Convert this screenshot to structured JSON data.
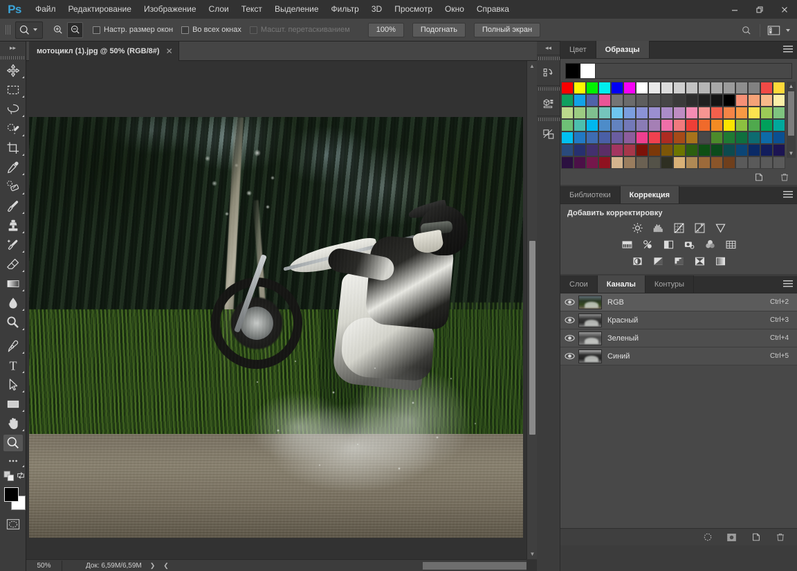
{
  "app": {
    "logo": "Ps",
    "title": "Adobe Photoshop"
  },
  "menubar": {
    "items": [
      {
        "label": "Файл"
      },
      {
        "label": "Редактирование"
      },
      {
        "label": "Изображение"
      },
      {
        "label": "Слои"
      },
      {
        "label": "Текст"
      },
      {
        "label": "Выделение"
      },
      {
        "label": "Фильтр"
      },
      {
        "label": "3D"
      },
      {
        "label": "Просмотр"
      },
      {
        "label": "Окно"
      },
      {
        "label": "Справка"
      }
    ]
  },
  "window_controls": {
    "minimize": "—",
    "restore": "❐",
    "close": "✕"
  },
  "optionsbar": {
    "tool_icon": "zoom-tool-icon",
    "zoom_in_icon": "zoom-in-icon",
    "zoom_out_icon": "zoom-out-icon",
    "checkboxes": [
      {
        "label": "Настр. размер окон",
        "checked": false,
        "disabled": false
      },
      {
        "label": "Во всех окнах",
        "checked": false,
        "disabled": false
      },
      {
        "label": "Масшт. перетаскиванием",
        "checked": false,
        "disabled": true
      }
    ],
    "buttons": [
      {
        "label": "100%"
      },
      {
        "label": "Подогнать"
      },
      {
        "label": "Полный экран"
      }
    ],
    "search_icon": "search-icon",
    "workspace_icon": "workspace-switcher-icon"
  },
  "toolbar": {
    "collapse_icon": "expand-arrows-icon",
    "tools": [
      {
        "name": "move-tool",
        "label": "Перемещение",
        "selected": false,
        "has_submenu": true
      },
      {
        "name": "marquee-tool",
        "label": "Прямоугольная область",
        "selected": false,
        "has_submenu": true
      },
      {
        "name": "lasso-tool",
        "label": "Лассо",
        "selected": false,
        "has_submenu": true
      },
      {
        "name": "quick-selection-tool",
        "label": "Быстрое выделение",
        "selected": false,
        "has_submenu": true
      },
      {
        "name": "crop-tool",
        "label": "Рамка",
        "selected": false,
        "has_submenu": true
      },
      {
        "name": "eyedropper-tool",
        "label": "Пипетка",
        "selected": false,
        "has_submenu": true
      },
      {
        "name": "healing-brush-tool",
        "label": "Восстанавливающая кисть",
        "selected": false,
        "has_submenu": true
      },
      {
        "name": "brush-tool",
        "label": "Кисть",
        "selected": false,
        "has_submenu": true
      },
      {
        "name": "clone-stamp-tool",
        "label": "Штамп",
        "selected": false,
        "has_submenu": true
      },
      {
        "name": "history-brush-tool",
        "label": "Архивная кисть",
        "selected": false,
        "has_submenu": true
      },
      {
        "name": "eraser-tool",
        "label": "Ластик",
        "selected": false,
        "has_submenu": true
      },
      {
        "name": "gradient-tool",
        "label": "Градиент",
        "selected": false,
        "has_submenu": true
      },
      {
        "name": "blur-tool",
        "label": "Размытие",
        "selected": false,
        "has_submenu": true
      },
      {
        "name": "dodge-tool",
        "label": "Осветлитель",
        "selected": false,
        "has_submenu": true
      },
      {
        "name": "pen-tool",
        "label": "Перо",
        "selected": false,
        "has_submenu": true
      },
      {
        "name": "type-tool",
        "label": "Текст",
        "selected": false,
        "has_submenu": true
      },
      {
        "name": "path-selection-tool",
        "label": "Выделение контура",
        "selected": false,
        "has_submenu": true
      },
      {
        "name": "rectangle-tool",
        "label": "Прямоугольник",
        "selected": false,
        "has_submenu": true
      },
      {
        "name": "hand-tool",
        "label": "Рука",
        "selected": false,
        "has_submenu": true
      },
      {
        "name": "zoom-tool",
        "label": "Масштаб",
        "selected": true,
        "has_submenu": false
      },
      {
        "name": "edit-toolbar-tool",
        "label": "Редактировать панель инструментов",
        "selected": false,
        "has_submenu": true
      }
    ],
    "swap_colors_icon": "swap-colors-icon",
    "default_colors_icon": "default-colors-icon",
    "foreground_color": "#000000",
    "background_color": "#ffffff",
    "quick_mask_icon": "quick-mask-icon"
  },
  "document": {
    "tab_title": "мотоцикл (1).jpg @ 50% (RGB/8#)",
    "close_label": "✕",
    "zoom_level": "50%",
    "doc_info": "Док: 6,59M/6,59M",
    "next_arrow": "❯",
    "prev_arrow": "❮",
    "image_description": "Мотоциклист на кроссовом мотоцикле в брызгах воды"
  },
  "icon_dock": {
    "collapse_icon": "collapse-arrows-icon",
    "items": [
      {
        "name": "history-panel-icon",
        "label": "История"
      },
      {
        "name": "properties-3d-panel-icon",
        "label": "3D"
      },
      {
        "name": "styles-panel-icon",
        "label": "Стили"
      }
    ]
  },
  "swatches_panel": {
    "tabs": [
      {
        "label": "Цвет",
        "active": false,
        "name": "tab-color"
      },
      {
        "label": "Образцы",
        "active": true,
        "name": "tab-swatches"
      }
    ],
    "menu_icon": "panel-menu-icon",
    "current_pair": {
      "foreground": "#000000",
      "background": "#ffffff"
    },
    "footer_buttons": [
      {
        "name": "new-swatch-button",
        "icon": "new-page-icon"
      },
      {
        "name": "delete-swatch-button",
        "icon": "trash-icon"
      }
    ],
    "scroll_up_icon": "chevron-up-icon",
    "scroll_down_icon": "chevron-down-icon",
    "grid": [
      [
        "#fb0000",
        "#fbf900",
        "#00f200",
        "#00eeee",
        "#0000f5",
        "#f800f8",
        "#ffffff",
        "#e8e8e8",
        "#dcdcdc",
        "#cfcfcf",
        "#c2c2c2",
        "#b5b5b5",
        "#a8a8a8",
        "#9b9b9b",
        "#8e8e8e",
        "#818181",
        "#f04a46",
        "#ffd93a"
      ],
      [
        "#0f9f5f",
        "#12a2e8",
        "#4f62a8",
        "#ea5596",
        "#757575",
        "#6b6b6b",
        "#5e5e5e",
        "#525252",
        "#464646",
        "#3a3a3a",
        "#2d2d2d",
        "#202020",
        "#141414",
        "#000000",
        "#f69076",
        "#f5a277",
        "#f7b98a",
        "#fbefa8"
      ],
      [
        "#bcd88c",
        "#9ccb82",
        "#80c08f",
        "#75c5bc",
        "#6ec6ef",
        "#7b9ede",
        "#8b93d6",
        "#9a8fd0",
        "#ab8cc8",
        "#be8cc3",
        "#f58cb4",
        "#f79592",
        "#f4604c",
        "#f58446",
        "#f89a44",
        "#fbe24f",
        "#9ccb57",
        "#7ec47f"
      ],
      [
        "#6ec076",
        "#4cbfae",
        "#00b7ef",
        "#4d8cc9",
        "#6383bf",
        "#7379b8",
        "#8a7cb5",
        "#a57fb5",
        "#ef6fa8",
        "#f17a7e",
        "#ee3f37",
        "#f06a2b",
        "#f28b23",
        "#fbe400",
        "#8cc040",
        "#4fa94d",
        "#00a05b",
        "#00a89c"
      ],
      [
        "#00c0f0",
        "#2179c4",
        "#3e6cb2",
        "#4a5fa6",
        "#6a5da0",
        "#8c5d9c",
        "#ef3f8f",
        "#f0414f",
        "#ad2b22",
        "#a64a18",
        "#a8731b",
        "#adа300",
        "#4c8a2b",
        "#1f7a33",
        "#0f6f3f",
        "#0d6b70",
        "#0d6aa8",
        "#0b4f91"
      ],
      [
        "#2a4a7c",
        "#27306f",
        "#43306e",
        "#5b2e66",
        "#a33560",
        "#a6374a",
        "#7c1208",
        "#7c3808",
        "#7c5608",
        "#6d7500",
        "#2c5f10",
        "#0e4f14",
        "#0b4b1c",
        "#0d4a4e",
        "#0b4576",
        "#0a2a66",
        "#121d5c",
        "#1c1452"
      ],
      [
        "#2b1040",
        "#4b1047",
        "#75174b",
        "#8f1220",
        "#d4b48e",
        "#9a7d5e",
        "#6b6152",
        "#545248",
        "#2e2f22",
        "#d9b177",
        "#b08a55",
        "#9c6a3a",
        "#8a552a",
        "#6f3f1c",
        "#5a5a5a",
        "#5a5a5a",
        "#5a5a5a",
        "#5a5a5a"
      ]
    ]
  },
  "adjustments_panel": {
    "tabs": [
      {
        "label": "Библиотеки",
        "active": false,
        "name": "tab-libraries"
      },
      {
        "label": "Коррекция",
        "active": true,
        "name": "tab-adjustments"
      }
    ],
    "menu_icon": "panel-menu-icon",
    "title": "Добавить корректировку",
    "rows": [
      [
        {
          "name": "brightness-contrast-icon",
          "label": "Яркость/Контрастность"
        },
        {
          "name": "levels-icon",
          "label": "Уровни"
        },
        {
          "name": "curves-icon",
          "label": "Кривые"
        },
        {
          "name": "exposure-icon",
          "label": "Экспозиция"
        },
        {
          "name": "vibrance-icon",
          "label": "Сочность"
        }
      ],
      [
        {
          "name": "hue-saturation-icon",
          "label": "Цветовой тон/Насыщенность"
        },
        {
          "name": "color-balance-icon",
          "label": "Цветовой баланс"
        },
        {
          "name": "black-white-icon",
          "label": "Черно-белое"
        },
        {
          "name": "photo-filter-icon",
          "label": "Фотофильтр"
        },
        {
          "name": "channel-mixer-icon",
          "label": "Микширование каналов"
        },
        {
          "name": "color-lookup-icon",
          "label": "Поиск цвета"
        }
      ],
      [
        {
          "name": "invert-icon",
          "label": "Инверсия"
        },
        {
          "name": "posterize-icon",
          "label": "Постеризация"
        },
        {
          "name": "threshold-icon",
          "label": "Изогелия"
        },
        {
          "name": "selective-color-icon",
          "label": "Выборочная коррекция цвета"
        },
        {
          "name": "gradient-map-icon",
          "label": "Карта градиента"
        }
      ]
    ]
  },
  "channels_panel": {
    "tabs": [
      {
        "label": "Слои",
        "active": false,
        "name": "tab-layers"
      },
      {
        "label": "Каналы",
        "active": true,
        "name": "tab-channels"
      },
      {
        "label": "Контуры",
        "active": false,
        "name": "tab-paths"
      }
    ],
    "menu_icon": "panel-menu-icon",
    "rows": [
      {
        "name": "RGB",
        "shortcut": "Ctrl+2",
        "visible": true,
        "selected": true
      },
      {
        "name": "Красный",
        "shortcut": "Ctrl+3",
        "visible": true,
        "selected": false
      },
      {
        "name": "Зеленый",
        "shortcut": "Ctrl+4",
        "visible": true,
        "selected": false
      },
      {
        "name": "Синий",
        "shortcut": "Ctrl+5",
        "visible": true,
        "selected": false
      }
    ],
    "footer_buttons": [
      {
        "name": "load-channel-as-selection-button",
        "icon": "marching-ants-icon"
      },
      {
        "name": "save-selection-as-channel-button",
        "icon": "mask-icon"
      },
      {
        "name": "new-channel-button",
        "icon": "new-page-icon"
      },
      {
        "name": "delete-channel-button",
        "icon": "trash-icon"
      }
    ]
  },
  "colors": {
    "app_bg": "#323232",
    "panel_bg": "#484848",
    "toolbar_bg": "#3c3c3c",
    "tab_active_bg": "#484848",
    "accent_blue": "#3ba4d8",
    "row_selected": "#5b5b5b"
  }
}
